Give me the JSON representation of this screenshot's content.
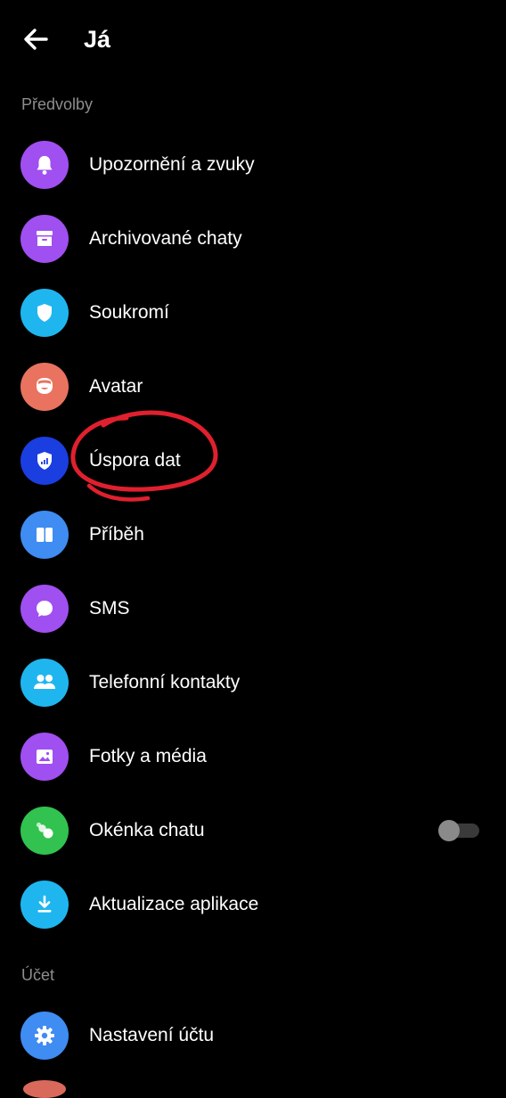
{
  "header": {
    "title": "Já",
    "back_icon": "arrow-left-icon"
  },
  "sections": {
    "preferences_title": "Předvolby",
    "account_title": "Účet"
  },
  "items": [
    {
      "label": "Upozornění a zvuky",
      "icon": "bell-icon",
      "color": "#a04ff0"
    },
    {
      "label": "Archivované chaty",
      "icon": "archive-icon",
      "color": "#a04ff0"
    },
    {
      "label": "Soukromí",
      "icon": "shield-icon",
      "color": "#1fb6ef"
    },
    {
      "label": "Avatar",
      "icon": "avatar-icon",
      "color": "#e9735f"
    },
    {
      "label": "Úspora dat",
      "icon": "data-saver-shield-icon",
      "color": "#1a3ee0"
    },
    {
      "label": "Příběh",
      "icon": "story-icon",
      "color": "#3f8cf2"
    },
    {
      "label": "SMS",
      "icon": "chat-bubble-icon",
      "color": "#a04ff0"
    },
    {
      "label": "Telefonní kontakty",
      "icon": "people-icon",
      "color": "#1fb6ef"
    },
    {
      "label": "Fotky a média",
      "icon": "photo-icon",
      "color": "#a04ff0"
    },
    {
      "label": "Okénka chatu",
      "icon": "chat-heads-icon",
      "color": "#31c24f",
      "toggle_on": false
    },
    {
      "label": "Aktualizace aplikace",
      "icon": "download-icon",
      "color": "#1fb6ef"
    }
  ],
  "account_items": [
    {
      "label": "Nastavení účtu",
      "icon": "gear-icon",
      "color": "#3f8cf2"
    }
  ],
  "annotation": {
    "color": "#e0202e",
    "target": "Úspora dat"
  }
}
